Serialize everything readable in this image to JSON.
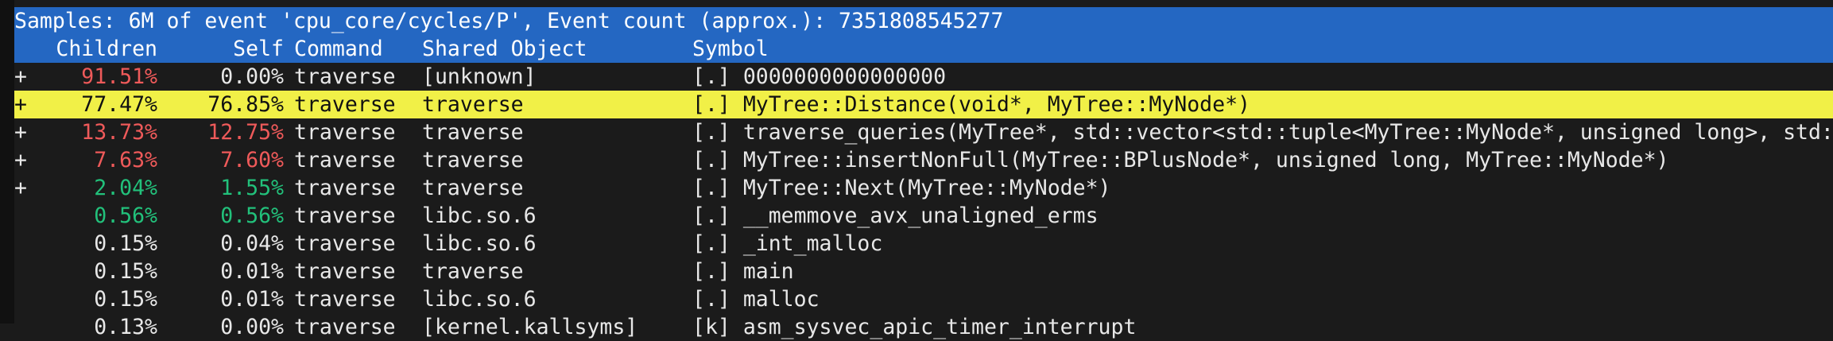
{
  "summary": "Samples: 6M of event 'cpu_core/cycles/P', Event count (approx.): 7351808545277",
  "columns": {
    "children": "Children",
    "self": "Self",
    "command": "Command",
    "shared_object": "Shared Object",
    "symbol": "Symbol"
  },
  "rows": [
    {
      "expand": "+",
      "children": "91.51%",
      "self": "0.00%",
      "command": "traverse",
      "object": "[unknown]",
      "symbol": "[.] 0000000000000000"
    },
    {
      "expand": "+",
      "children": "77.47%",
      "self": "76.85%",
      "command": "traverse",
      "object": "traverse",
      "symbol": "[.] MyTree::Distance(void*, MyTree::MyNode*)"
    },
    {
      "expand": "+",
      "children": "13.73%",
      "self": "12.75%",
      "command": "traverse",
      "object": "traverse",
      "symbol": "[.] traverse_queries(MyTree*, std::vector<std::tuple<MyTree::MyNode*, unsigned long>, std::"
    },
    {
      "expand": "+",
      "children": "7.63%",
      "self": "7.60%",
      "command": "traverse",
      "object": "traverse",
      "symbol": "[.] MyTree::insertNonFull(MyTree::BPlusNode*, unsigned long, MyTree::MyNode*)"
    },
    {
      "expand": "+",
      "children": "2.04%",
      "self": "1.55%",
      "command": "traverse",
      "object": "traverse",
      "symbol": "[.] MyTree::Next(MyTree::MyNode*)"
    },
    {
      "expand": "",
      "children": "0.56%",
      "self": "0.56%",
      "command": "traverse",
      "object": "libc.so.6",
      "symbol": "[.] __memmove_avx_unaligned_erms"
    },
    {
      "expand": "",
      "children": "0.15%",
      "self": "0.04%",
      "command": "traverse",
      "object": "libc.so.6",
      "symbol": "[.] _int_malloc"
    },
    {
      "expand": "",
      "children": "0.15%",
      "self": "0.01%",
      "command": "traverse",
      "object": "traverse",
      "symbol": "[.] main"
    },
    {
      "expand": "",
      "children": "0.15%",
      "self": "0.01%",
      "command": "traverse",
      "object": "libc.so.6",
      "symbol": "[.] malloc"
    },
    {
      "expand": "",
      "children": "0.13%",
      "self": "0.00%",
      "command": "traverse",
      "object": "[kernel.kallsyms]",
      "symbol": "[k] asm_sysvec_apic_timer_interrupt"
    }
  ],
  "selected_row": 1,
  "colors": {
    "header_bg": "#2467c2",
    "selected_bg": "#f1f047",
    "high_percent": "#ef5a5a",
    "mid_percent": "#22c17b",
    "background": "#1b1b1b"
  }
}
